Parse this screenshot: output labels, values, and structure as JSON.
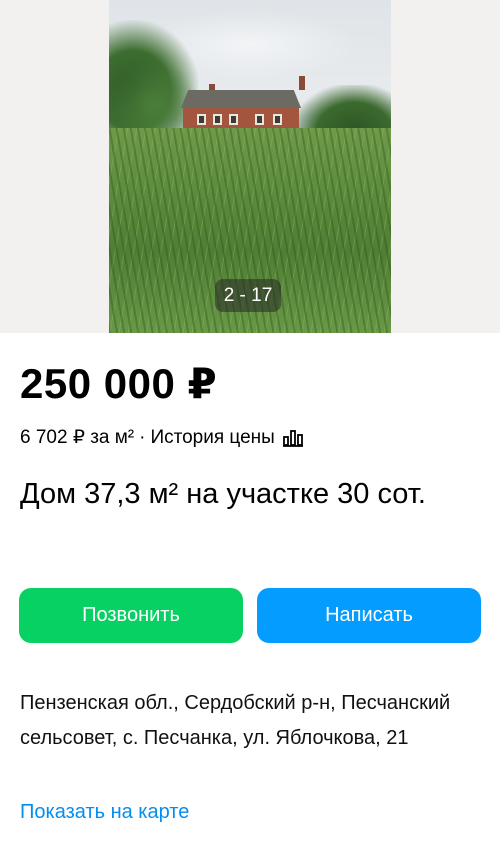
{
  "gallery": {
    "counter": "2 - 17"
  },
  "listing": {
    "price": "250 000 ₽",
    "price_per_m2": "6 702 ₽ за м²",
    "separator": "·",
    "price_history_label": "История цены",
    "price_history_icon": "bar-chart-icon",
    "title": "Дом 37,3 м² на участке 30 сот."
  },
  "actions": {
    "call_label": "Позвонить",
    "write_label": "Написать",
    "call_color": "#07d162",
    "write_color": "#049cff"
  },
  "location": {
    "address": "Пензенская обл., Сердобский р-н, Песчанский сельсовет, с. Песчанка, ул. Яблочкова, 21",
    "show_on_map_label": "Показать на карте",
    "link_color": "#048ef0"
  }
}
